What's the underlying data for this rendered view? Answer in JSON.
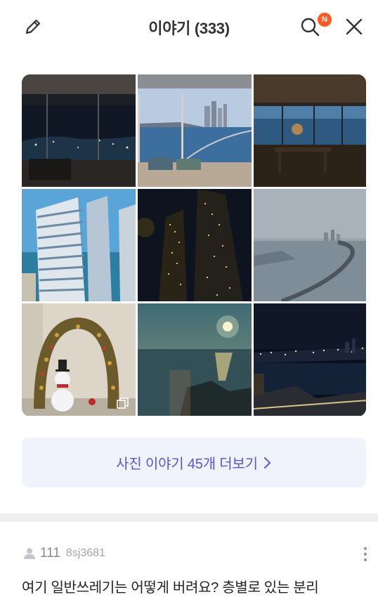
{
  "header": {
    "title": "이야기 (333)",
    "badge": "N",
    "icons": {
      "edit": "pencil-icon",
      "search": "search-icon",
      "close": "close-icon"
    },
    "badge_color": "#ff5a1f"
  },
  "photos": {
    "tile_count": 9,
    "tiles": [
      "night city view through living room window",
      "bay bridge and skyline daytime view from window",
      "dusk sea view from dining room",
      "glass skyscraper towers",
      "towers lit at night",
      "misty bridge over the sea",
      "christmas snowman with wreath arch",
      "sunset over the sea",
      "night harbor and city lights"
    ],
    "multi_icon": "multi-photo-icon"
  },
  "more_button": {
    "label": "사진 이야기 45개 더보기",
    "icon": "chevron-right-icon",
    "accent": "#5a55d8",
    "background": "#f1f3fc"
  },
  "post": {
    "floor": "111",
    "author": "8sj3681",
    "text": "여기 일반쓰레기는 어떻게 버려요? 층별로 있는 분리",
    "icons": {
      "author": "person-icon",
      "menu": "kebab-menu-icon"
    }
  }
}
